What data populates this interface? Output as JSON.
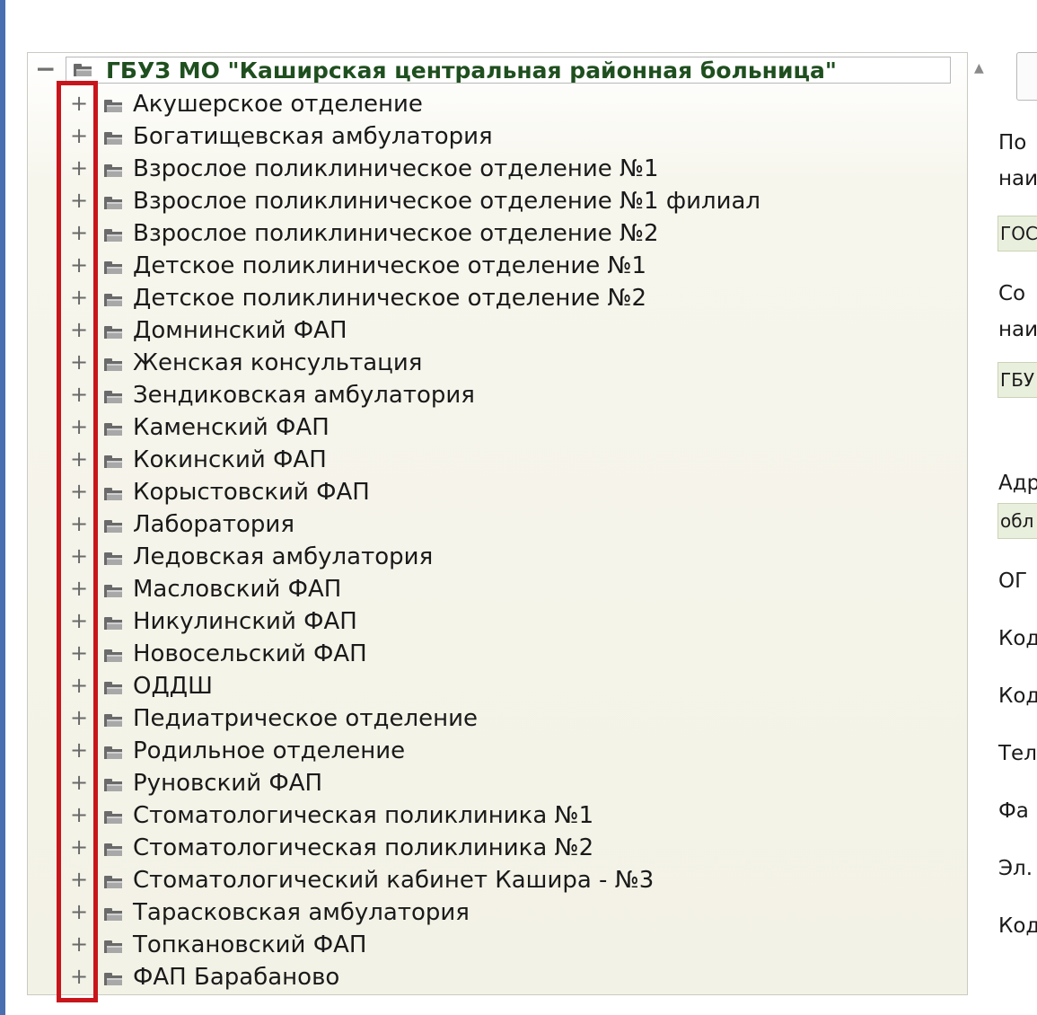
{
  "tree": {
    "root": {
      "toggle": "−",
      "label": "ГБУЗ МО \"Каширская центральная районная больница\""
    },
    "children": [
      "Акушерское отделение",
      "Богатищевская амбулатория",
      "Взрослое поликлиническое отделение №1",
      "Взрослое поликлиническое отделение №1 филиал",
      "Взрослое поликлиническое отделение №2",
      "Детское поликлиническое отделение №1",
      "Детское поликлиническое отделение №2",
      "Домнинский ФАП",
      "Женская консультация",
      "Зендиковская амбулатория",
      "Каменский ФАП",
      "Кокинский ФАП",
      "Корыстовский ФАП",
      "Лаборатория",
      "Ледовская амбулатория",
      "Масловский ФАП",
      "Никулинский ФАП",
      "Новосельский ФАП",
      "ОДДШ",
      "Педиатрическое отделение",
      "Родильное отделение",
      "Руновский ФАП",
      "Стоматологическая поликлиника №1",
      "Стоматологическая поликлиника №2",
      "Стоматологический кабинет Кашира - №3",
      "Тарасковская амбулатория",
      "Топкановский ФАП",
      "ФАП Барабаново"
    ],
    "expand_symbol": "+",
    "scroll_up_symbol": "▲"
  },
  "right_panel": {
    "labels": [
      "По",
      "наи",
      "Со",
      "наи",
      "Адр",
      "ОГ",
      "Код",
      "Код",
      "Тел",
      "Фа",
      "Эл.",
      "Код"
    ],
    "fields": [
      "ГОС",
      "ГБУ",
      "обл"
    ]
  },
  "colors": {
    "highlight": "#c8151b",
    "root_text": "#1f4f1f",
    "field_bg": "#e9efdd"
  }
}
